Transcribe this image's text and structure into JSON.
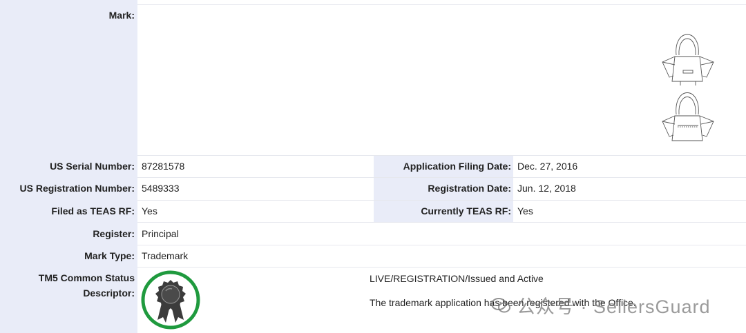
{
  "mark": {
    "label": "Mark:"
  },
  "left_fields": [
    {
      "label": "US Serial Number:",
      "value": "87281578"
    },
    {
      "label": "US Registration Number:",
      "value": "5489333"
    },
    {
      "label": "Filed as TEAS RF:",
      "value": "Yes"
    },
    {
      "label": "Register:",
      "value": "Principal"
    },
    {
      "label": "Mark Type:",
      "value": "Trademark"
    }
  ],
  "right_fields": [
    {
      "label": "Application Filing Date:",
      "value": "Dec. 27, 2016"
    },
    {
      "label": "Registration Date:",
      "value": "Jun. 12, 2018"
    },
    {
      "label": "Currently TEAS RF:",
      "value": "Yes"
    }
  ],
  "status": {
    "label_line1": "TM5 Common Status",
    "label_line2": "Descriptor:",
    "line1": "LIVE/REGISTRATION/Issued and Active",
    "line2": "The trademark application has been registered with the Office."
  },
  "watermark": {
    "text": "公众号 · SellersGuard"
  },
  "colors": {
    "label_bg": "#e9ecf8",
    "seal_green": "#1f9a3e",
    "seal_dark": "#3c3c3c"
  }
}
